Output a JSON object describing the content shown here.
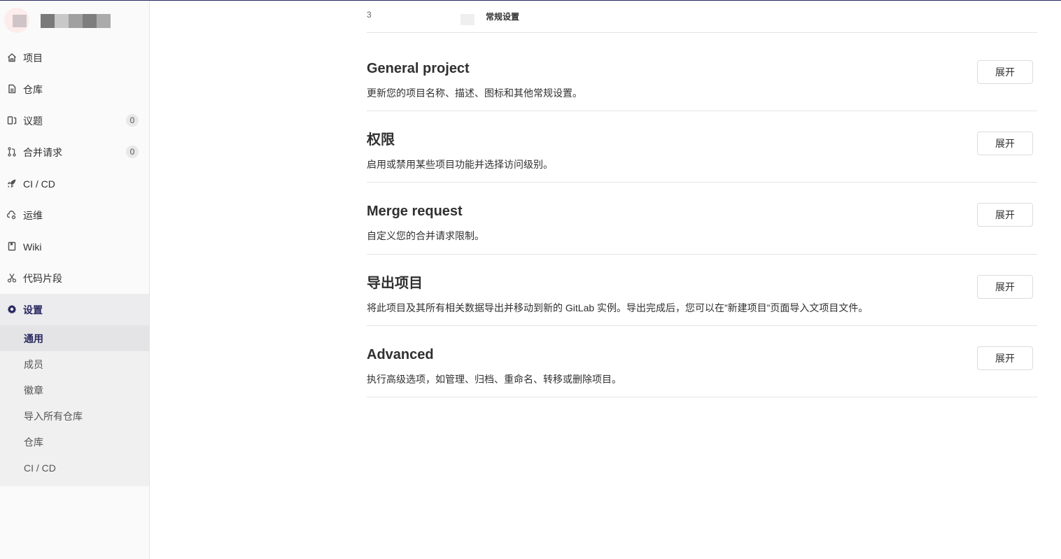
{
  "sidebar": {
    "nav": [
      {
        "label": "项目",
        "icon": "home-icon"
      },
      {
        "label": "仓库",
        "icon": "document-icon"
      },
      {
        "label": "议题",
        "icon": "issues-icon",
        "badge": "0"
      },
      {
        "label": "合并请求",
        "icon": "merge-request-icon",
        "badge": "0"
      },
      {
        "label": "CI / CD",
        "icon": "rocket-icon"
      },
      {
        "label": "运维",
        "icon": "cloud-gear-icon"
      },
      {
        "label": "Wiki",
        "icon": "book-icon"
      },
      {
        "label": "代码片段",
        "icon": "scissors-icon"
      },
      {
        "label": "设置",
        "icon": "gear-icon"
      }
    ],
    "settings_sub": [
      {
        "label": "通用"
      },
      {
        "label": "成员"
      },
      {
        "label": "徽章"
      },
      {
        "label": "导入所有仓库"
      },
      {
        "label": "仓库"
      },
      {
        "label": "CI / CD"
      }
    ]
  },
  "breadcrumb": {
    "fragment": "3",
    "current": "常规设置"
  },
  "sections": [
    {
      "title": "General project",
      "description": "更新您的项目名称、描述、图标和其他常规设置。",
      "button": "展开"
    },
    {
      "title": "权限",
      "description": "启用或禁用某些项目功能并选择访问级别。",
      "button": "展开"
    },
    {
      "title": "Merge request",
      "description": "自定义您的合并请求限制。",
      "button": "展开"
    },
    {
      "title": "导出项目",
      "description": "将此项目及其所有相关数据导出并移动到新的 GitLab 实例。导出完成后，您可以在”新建项目”页面导入文项目文件。",
      "button": "展开"
    },
    {
      "title": "Advanced",
      "description": "执行高级选项，如管理、归档、重命名、转移或删除项目。",
      "button": "展开"
    }
  ],
  "colors": {
    "accent": "#292961",
    "sidebar_bg": "#fafafa",
    "border": "#e5e5e5"
  }
}
